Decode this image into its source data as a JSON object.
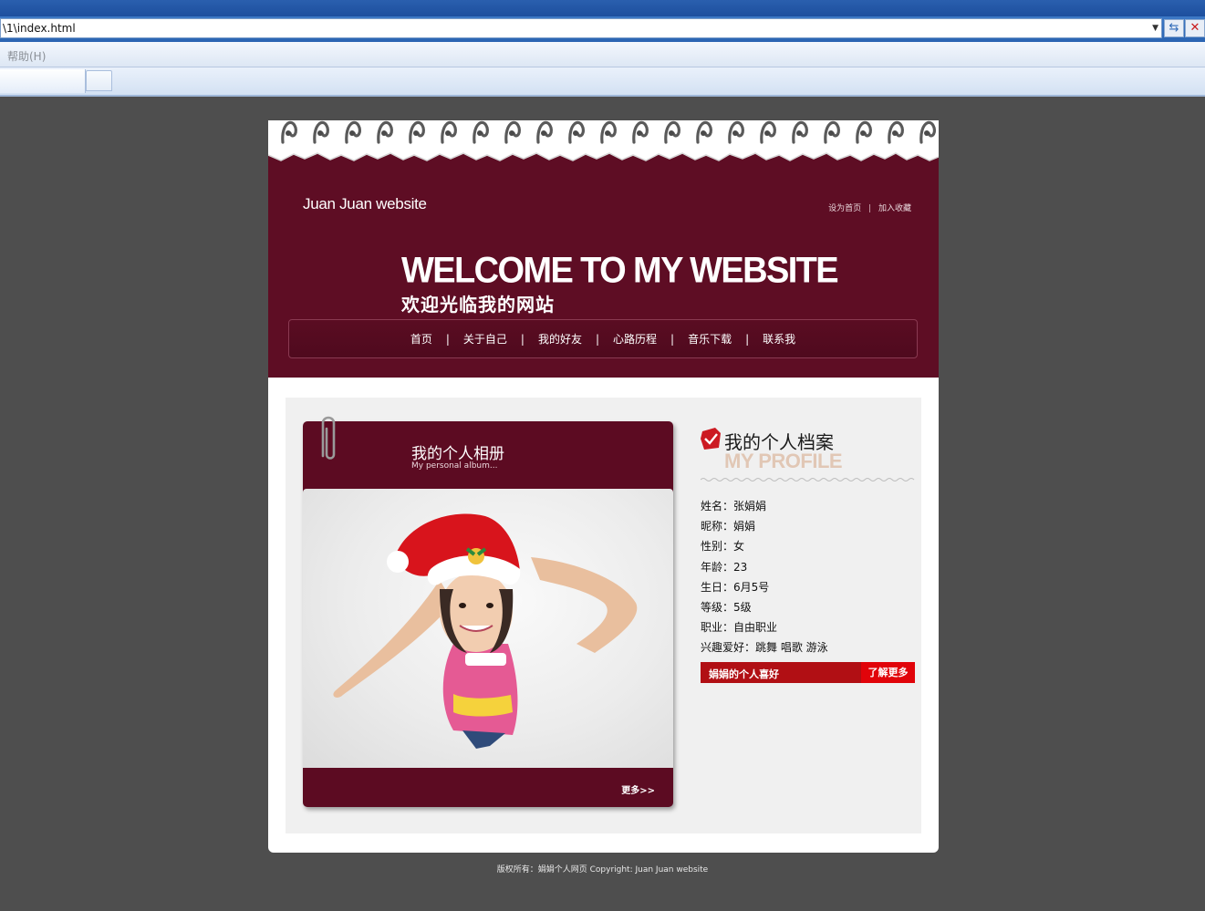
{
  "browser": {
    "address": "\\1\\index.html",
    "menu_help": "帮助(H)"
  },
  "header": {
    "site_title": "Juan Juan website",
    "set_home": "设为首页",
    "separator": "|",
    "add_favorite": "加入收藏",
    "welcome_en": "WELCOME TO MY WEBSITE",
    "welcome_cn": "欢迎光临我的网站"
  },
  "nav": {
    "separator": "|",
    "items": [
      "首页",
      "关于自己",
      "我的好友",
      "心路历程",
      "音乐下载",
      "联系我"
    ]
  },
  "album": {
    "title": "我的个人相册",
    "subtitle": "My personal album...",
    "more": "更多>>"
  },
  "profile": {
    "title_cn": "我的个人档案",
    "title_en": "MY PROFILE",
    "fields": [
      "姓名：张娟娟",
      "昵称：娟娟",
      "性别：女",
      "年龄：23",
      "生日：6月5号",
      "等级：5级",
      "职业：自由职业",
      "兴趣爱好：跳舞 唱歌 游泳"
    ],
    "hobby_label": "娟娟的个人喜好",
    "hobby_more": "了解更多"
  },
  "footer": {
    "copyright": "版权所有：娟娟个人网页 Copyright: Juan Juan website"
  },
  "colors": {
    "burgundy": "#5e0d24",
    "page_bg": "#4e4e4e",
    "red_button": "#e1040a"
  }
}
